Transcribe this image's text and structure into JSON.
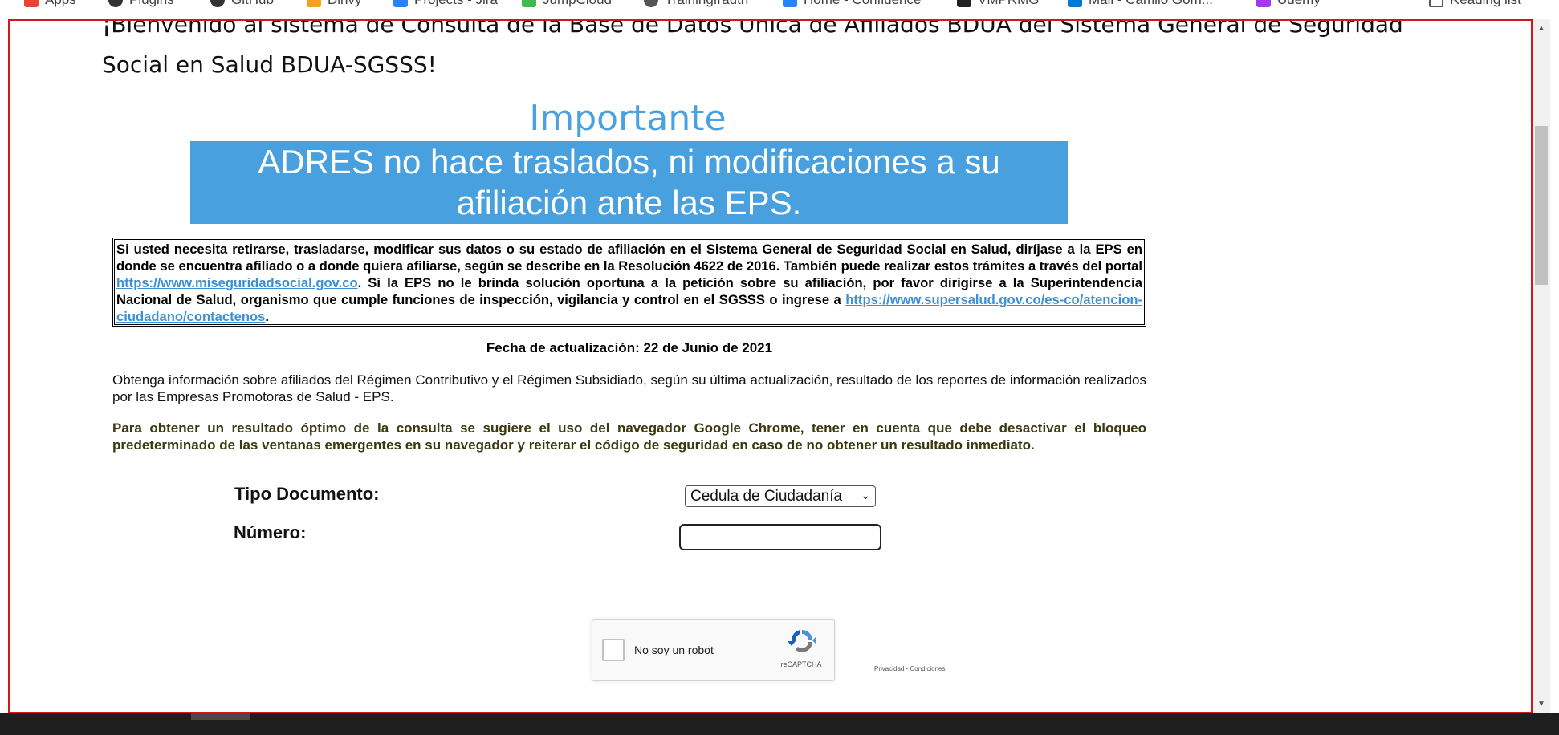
{
  "bookmarks": [
    {
      "label": "Apps",
      "color": "#ea4335"
    },
    {
      "label": "Plugins",
      "color": "#333333"
    },
    {
      "label": "GitHub",
      "color": "#333333"
    },
    {
      "label": "Dinvy",
      "color": "#f4a21c"
    },
    {
      "label": "Projects - Jira",
      "color": "#2684ff"
    },
    {
      "label": "JumpCloud",
      "color": "#3fb950"
    },
    {
      "label": "Trainingfrauth",
      "color": "#555555"
    },
    {
      "label": "Home - Confluence",
      "color": "#2684ff"
    },
    {
      "label": "VMPRMG",
      "color": "#222222"
    },
    {
      "label": "Mail - Camilo Gom...",
      "color": "#0078d4"
    },
    {
      "label": "Udemy",
      "color": "#a435f0"
    }
  ],
  "reading_list": "Reading list",
  "welcome": "¡Bienvenido al sistema de Consulta de la Base de Datos Única de Afiliados BDUA del Sistema General de Seguridad Social en Salud BDUA-SGSSS!",
  "importante": "Importante",
  "banner": "ADRES no hace traslados, ni modificaciones a su afiliación ante las EPS.",
  "notice": {
    "part1": "Si usted necesita retirarse, trasladarse, modificar sus datos o su estado de afiliación en el Sistema General de Seguridad Social en Salud, diríjase a la EPS en donde se encuentra afiliado o a donde quiera afiliarse, según se describe en la Resolución 4622 de 2016. También puede realizar estos trámites a través del portal ",
    "link1": "https://www.miseguridadsocial.gov.co",
    "part2": ". Si la EPS no le brinda solución oportuna a la petición sobre su afiliación, por favor dirigirse a la Superintendencia Nacional de Salud, organismo que cumple funciones de inspección, vigilancia y control en el SGSSS o ingrese a ",
    "link2": "https://www.supersalud.gov.co/es-co/atencion-ciudadano/contactenos",
    "part3": "."
  },
  "fecha": "Fecha de actualización: 22 de Junio de 2021",
  "info": "Obtenga información sobre afiliados del Régimen Contributivo y el Régimen Subsidiado, según su última actualización, resultado de los reportes de información realizados por las Empresas Promotoras de Salud - EPS.",
  "chrome_note": "Para obtener un resultado óptimo de la consulta se sugiere el uso del navegador Google Chrome, tener en cuenta que debe desactivar el bloqueo predeterminado de las ventanas emergentes en su navegador y reiterar el código de seguridad en caso de no obtener un resultado inmediato.",
  "form": {
    "tipo_label": "Tipo Documento:",
    "tipo_value": "Cedula de Ciudadanía",
    "numero_label": "Número:",
    "numero_value": ""
  },
  "captcha": {
    "label": "No soy un robot",
    "brand": "reCAPTCHA",
    "privacy": "Privacidad - Condiciones"
  },
  "colors": {
    "accent_blue": "#49a0de",
    "frame_red": "#d0191f",
    "link_blue": "#3a8fd6"
  }
}
